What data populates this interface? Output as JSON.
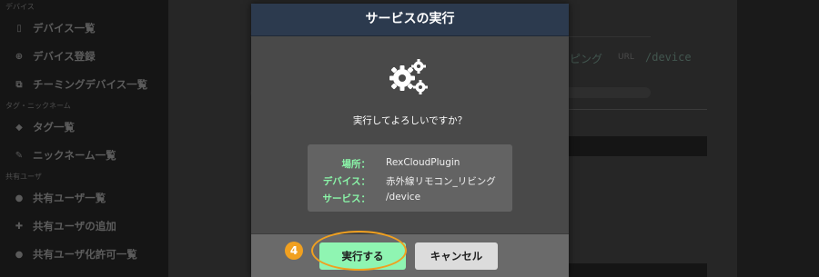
{
  "sidebar": {
    "sections": [
      {
        "title": "デバイス",
        "items": [
          {
            "icon": "phone-icon",
            "glyph": "▯",
            "label": "デバイス一覧"
          },
          {
            "icon": "plus-circle-icon",
            "glyph": "⊕",
            "label": "デバイス登録"
          },
          {
            "icon": "clone-icon",
            "glyph": "⧉",
            "label": "チーミングデバイス一覧"
          }
        ]
      },
      {
        "title": "タグ・ニックネーム",
        "items": [
          {
            "icon": "tags-icon",
            "glyph": "◆",
            "label": "タグ一覧"
          },
          {
            "icon": "pencil-icon",
            "glyph": "✎",
            "label": "ニックネーム一覧"
          }
        ]
      },
      {
        "title": "共有ユーザ",
        "items": [
          {
            "icon": "user-icon",
            "glyph": "●",
            "label": "共有ユーザ一覧"
          },
          {
            "icon": "user-plus-icon",
            "glyph": "✚",
            "label": "共有ユーザの追加"
          },
          {
            "icon": "user-lock-icon",
            "glyph": "●",
            "label": "共有ユーザ化許可一覧"
          }
        ]
      }
    ]
  },
  "background": {
    "fragment_text": "ピング",
    "url_label": "URL",
    "url_value": "/device"
  },
  "modal": {
    "title": "サービスの実行",
    "question": "実行してよろしいですか？",
    "info": [
      {
        "label": "場所：",
        "value": "RexCloudPlugin"
      },
      {
        "label": "デバイス：",
        "value": "赤外線リモコン_リビング"
      },
      {
        "label": "サービス：",
        "value": "/device"
      }
    ],
    "execute_label": "実行する",
    "cancel_label": "キャンセル"
  },
  "annotation": {
    "step_number": "4",
    "color": "#f0a020"
  },
  "colors": {
    "accent_green": "#8ff5b2",
    "header_blue": "#2c3a4e",
    "info_label_green": "#8af5a8"
  }
}
